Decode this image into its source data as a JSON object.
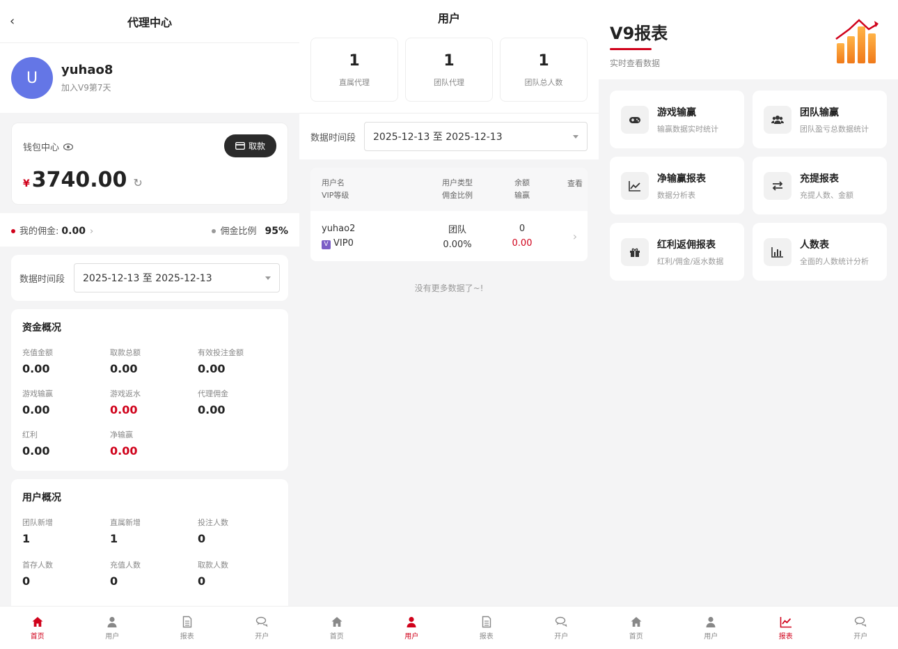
{
  "agent": {
    "header_title": "代理中心",
    "user_initial": "U",
    "username": "yuhao8",
    "joined": "加入V9第7天",
    "wallet_label": "钱包中心",
    "withdraw_btn": "取款",
    "currency": "¥",
    "balance": "3740.00",
    "my_commission_label": "我的佣金:",
    "my_commission_value": "0.00",
    "rate_label": "佣金比例",
    "rate_value": "95%",
    "date_label": "数据时间段",
    "date_value": "2025-12-13 至 2025-12-13",
    "funds_title": "资金概况",
    "funds": [
      {
        "label": "充值金额",
        "value": "0.00",
        "red": false
      },
      {
        "label": "取款总额",
        "value": "0.00",
        "red": false
      },
      {
        "label": "有效投注金额",
        "value": "0.00",
        "red": false
      },
      {
        "label": "游戏输赢",
        "value": "0.00",
        "red": false
      },
      {
        "label": "游戏返水",
        "value": "0.00",
        "red": true
      },
      {
        "label": "代理佣金",
        "value": "0.00",
        "red": false
      },
      {
        "label": "红利",
        "value": "0.00",
        "red": false
      },
      {
        "label": "净输赢",
        "value": "0.00",
        "red": true
      }
    ],
    "users_title": "用户概况",
    "users": [
      {
        "label": "团队新增",
        "value": "1"
      },
      {
        "label": "直属新增",
        "value": "1"
      },
      {
        "label": "投注人数",
        "value": "0"
      },
      {
        "label": "首存人数",
        "value": "0"
      },
      {
        "label": "充值人数",
        "value": "0"
      },
      {
        "label": "取款人数",
        "value": "0"
      }
    ]
  },
  "users_page": {
    "header_title": "用户",
    "stats": [
      {
        "value": "1",
        "label": "直属代理"
      },
      {
        "value": "1",
        "label": "团队代理"
      },
      {
        "value": "1",
        "label": "团队总人数"
      }
    ],
    "date_label": "数据时间段",
    "date_value": "2025-12-13 至 2025-12-13",
    "col1a": "用户名",
    "col1b": "VIP等级",
    "col2a": "用户类型",
    "col2b": "佣金比例",
    "col3a": "余额",
    "col3b": "输赢",
    "col4": "查看",
    "row": {
      "name": "yuhao2",
      "vip": "VIP0",
      "vip_badge": "V",
      "type": "团队",
      "rate": "0.00%",
      "balance": "0",
      "winloss": "0.00"
    },
    "no_more": "没有更多数据了~!"
  },
  "reports": {
    "title": "V9报表",
    "subtitle": "实时查看数据",
    "cards": [
      {
        "title": "游戏输赢",
        "desc": "输赢数据实时统计",
        "icon": "gamepad-icon"
      },
      {
        "title": "团队输赢",
        "desc": "团队盈亏总数据统计",
        "icon": "users-icon"
      },
      {
        "title": "净输赢报表",
        "desc": "数据分析表",
        "icon": "line-chart-icon"
      },
      {
        "title": "充提报表",
        "desc": "充提人数、金额",
        "icon": "exchange-icon"
      },
      {
        "title": "红利返佣报表",
        "desc": "红利/佣金/返水数据",
        "icon": "gift-icon"
      },
      {
        "title": "人数表",
        "desc": "全面的人数统计分析",
        "icon": "bar-chart-icon"
      }
    ]
  },
  "tabs": [
    "首页",
    "用户",
    "报表",
    "开户"
  ],
  "colors": {
    "accent": "#d0021b",
    "avatar": "#6476e6"
  }
}
